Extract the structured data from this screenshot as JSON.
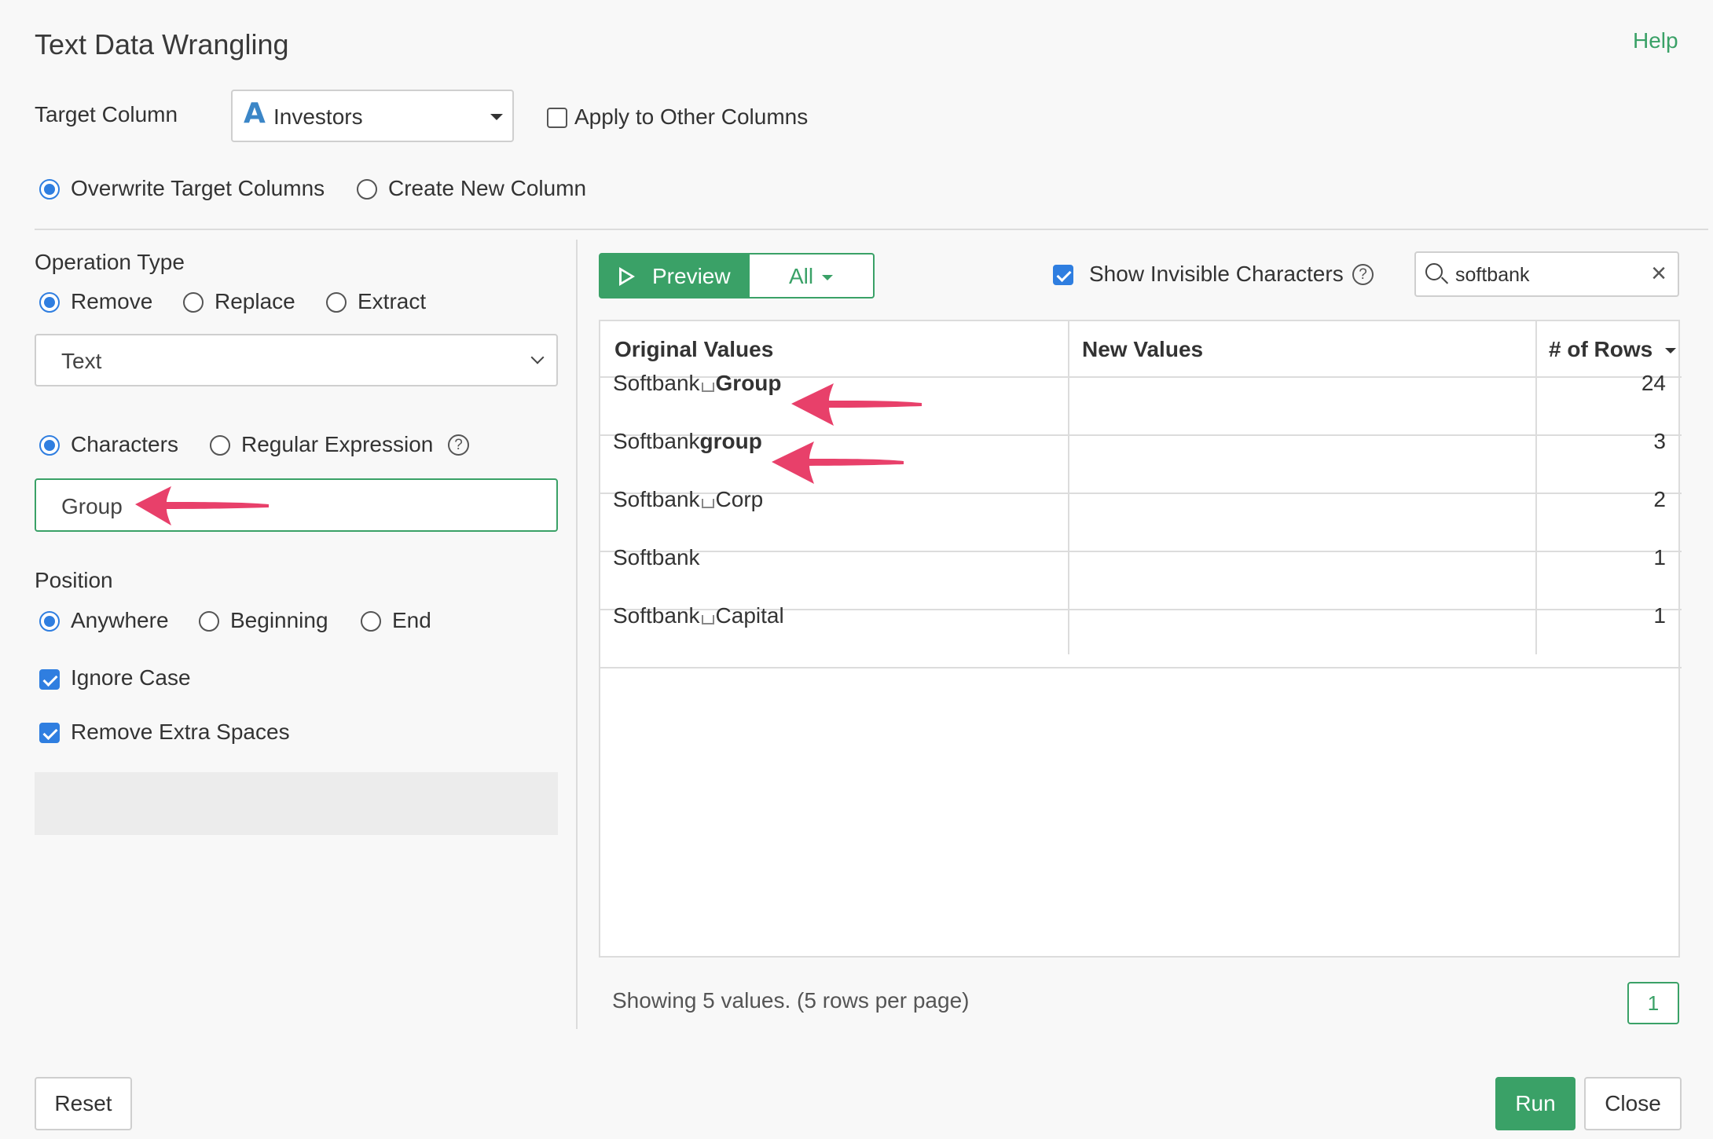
{
  "dialog": {
    "title": "Text Data Wrangling",
    "help": "Help"
  },
  "target": {
    "label": "Target Column",
    "type_icon": "A",
    "value": "Investors",
    "apply_other_label": "Apply to Other Columns",
    "apply_other_checked": false
  },
  "output_mode": {
    "overwrite_label": "Overwrite Target Columns",
    "create_label": "Create New Column",
    "selected": "overwrite"
  },
  "operation": {
    "label": "Operation Type",
    "options": [
      "Remove",
      "Replace",
      "Extract"
    ],
    "selected": "Remove",
    "kind_select": "Text"
  },
  "match_mode": {
    "characters_label": "Characters",
    "regex_label": "Regular Expression",
    "selected": "Characters",
    "input_value": "Group"
  },
  "position": {
    "label": "Position",
    "options": [
      "Anywhere",
      "Beginning",
      "End"
    ],
    "selected": "Anywhere"
  },
  "flags": {
    "ignore_case_label": "Ignore Case",
    "ignore_case": true,
    "remove_spaces_label": "Remove Extra Spaces",
    "remove_spaces": true
  },
  "preview": {
    "preview_label": "Preview",
    "all_label": "All",
    "show_invisible_label": "Show Invisible Characters",
    "show_invisible": true,
    "search_value": "softbank",
    "help_glyph": "?"
  },
  "table": {
    "headers": [
      "Original Values",
      "New Values",
      "# of Rows"
    ],
    "rows": [
      {
        "pre": "Softbank",
        "space": true,
        "bold": "Group",
        "post": "",
        "count": "24"
      },
      {
        "pre": "Softbank",
        "space": false,
        "bold": "group",
        "post": "",
        "count": "3"
      },
      {
        "pre": "Softbank",
        "space": true,
        "bold": "",
        "post": "Corp",
        "count": "2"
      },
      {
        "pre": "Softbank",
        "space": false,
        "bold": "",
        "post": "",
        "count": "1"
      },
      {
        "pre": "Softbank",
        "space": true,
        "bold": "",
        "post": "Capital",
        "count": "1"
      }
    ]
  },
  "pager": {
    "summary": "Showing 5 values. (5 rows per page)",
    "page": "1"
  },
  "buttons": {
    "reset": "Reset",
    "run": "Run",
    "close": "Close"
  },
  "colors": {
    "accent_green": "#3aa167",
    "radio_blue": "#2f7ee0",
    "annotation_arrow": "#e8406a"
  }
}
